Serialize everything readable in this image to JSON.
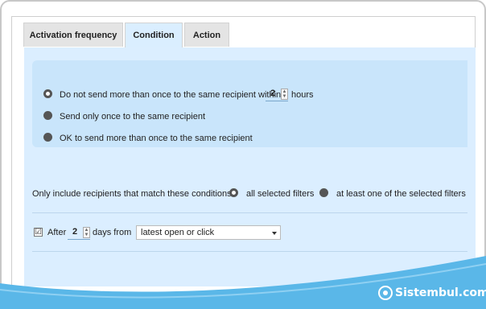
{
  "tabs": [
    {
      "label": "Activation frequency",
      "active": false
    },
    {
      "label": "Condition",
      "active": true
    },
    {
      "label": "Action",
      "active": false
    }
  ],
  "frequency": {
    "option1_prefix": "Do not send more than once to the same recipient within",
    "option1_value": "2",
    "option1_suffix": "hours",
    "option2": "Send only once to the same recipient",
    "option3": "OK to send more than once to the same recipient",
    "selected": 0
  },
  "filters": {
    "label": "Only include recipients that match these conditions:",
    "option_all": "all selected filters",
    "option_any": "at least one of the selected filters",
    "selected": "all"
  },
  "after": {
    "checked": true,
    "checkmark": "☑",
    "prefix": "After",
    "value": "2",
    "unit": "days from",
    "select_value": "latest open or click"
  },
  "watermark": {
    "text": "Sistembul.com"
  },
  "colors": {
    "panel": "#dbeeff",
    "box": "#c9e5fb",
    "accent": "#5ab7e8"
  }
}
